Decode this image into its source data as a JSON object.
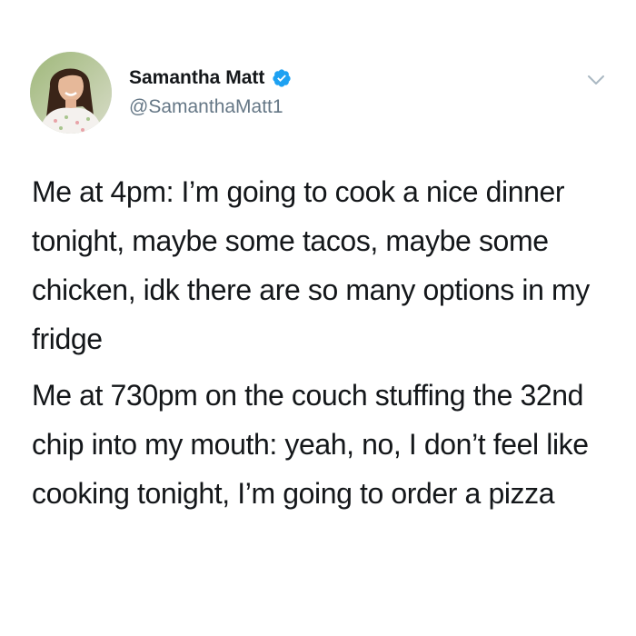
{
  "user": {
    "display_name": "Samantha Matt",
    "handle": "@SamanthaMatt1",
    "verified": true,
    "avatar_icon": "profile-photo"
  },
  "menu": {
    "icon": "chevron-down-icon"
  },
  "tweet": {
    "paragraphs": [
      "Me at 4pm: I’m going to cook a nice dinner tonight, maybe some tacos, maybe some chicken, idk there are so many options in my fridge",
      "Me at 730pm on the couch stuffing the 32nd chip into my mouth: yeah, no, I don’t feel like cooking tonight, I’m going to order a pizza"
    ]
  },
  "colors": {
    "text": "#14171a",
    "handle": "#657786",
    "verified": "#1da1f2",
    "chevron": "#aab8c2"
  }
}
